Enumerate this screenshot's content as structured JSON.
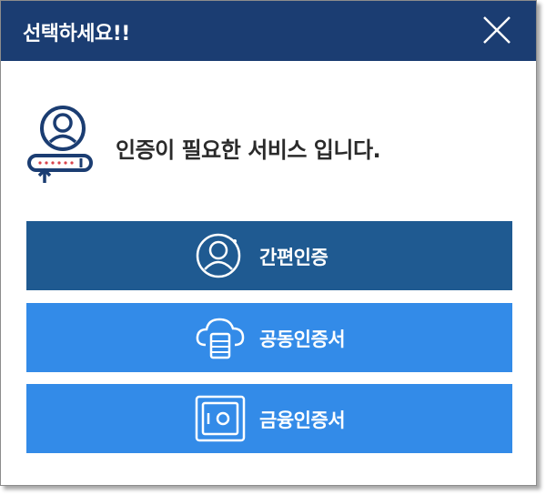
{
  "dialog": {
    "title": "선택하세요!!",
    "close_icon": "close-icon",
    "header_color": "#1b3d72"
  },
  "info": {
    "icon": "user-password-icon",
    "message": "인증이 필요한 서비스 입니다."
  },
  "options": [
    {
      "label": "간편인증",
      "icon": "user-circle-icon",
      "color": "#1f5a91"
    },
    {
      "label": "공동인증서",
      "icon": "cloud-server-icon",
      "color": "#338be8"
    },
    {
      "label": "금융인증서",
      "icon": "safe-icon",
      "color": "#338be8"
    }
  ]
}
